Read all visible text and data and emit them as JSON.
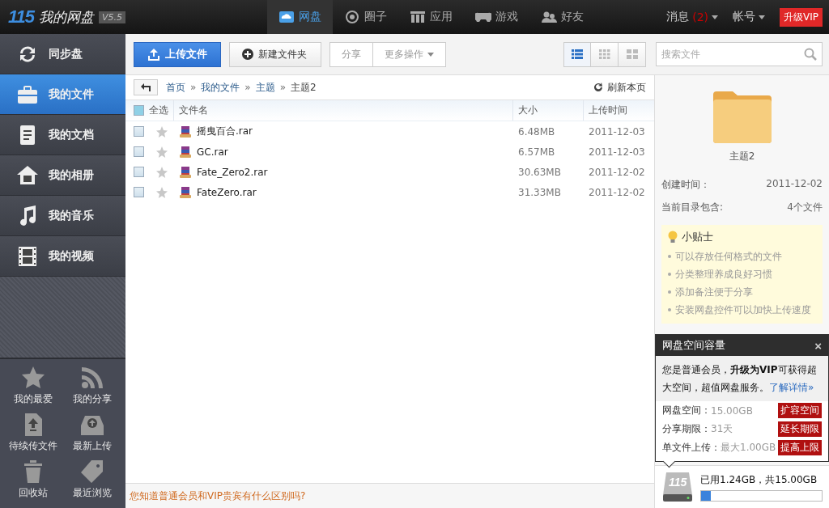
{
  "app": {
    "logo": "115",
    "title": "我的网盘",
    "version": "V5.5"
  },
  "nav_tabs": [
    {
      "label": "网盘",
      "selected": true
    },
    {
      "label": "圈子",
      "selected": false
    },
    {
      "label": "应用",
      "selected": false
    },
    {
      "label": "游戏",
      "selected": false
    },
    {
      "label": "好友",
      "selected": false
    }
  ],
  "header_right": {
    "messages": "消息",
    "message_count": "(2)",
    "account": "帐号",
    "upgrade": "升级VIP"
  },
  "sidebar": {
    "items": [
      {
        "label": "同步盘",
        "selected": false
      },
      {
        "label": "我的文件",
        "selected": true
      },
      {
        "label": "我的文档",
        "selected": false
      },
      {
        "label": "我的相册",
        "selected": false
      },
      {
        "label": "我的音乐",
        "selected": false
      },
      {
        "label": "我的视频",
        "selected": false
      }
    ],
    "shortcuts": [
      "我的最爱",
      "我的分享",
      "待续传文件",
      "最新上传",
      "回收站",
      "最近浏览"
    ]
  },
  "toolbar": {
    "upload": "上传文件",
    "new_folder": "新建文件夹",
    "share": "分享",
    "more": "更多操作",
    "views": [
      {
        "selected": true
      },
      {
        "selected": false
      },
      {
        "selected": false
      }
    ]
  },
  "search": {
    "placeholder": "搜索文件"
  },
  "breadcrumb": [
    {
      "label": "首页"
    },
    {
      "separator": "»",
      "label": "我的文件"
    },
    {
      "separator": "»",
      "label": "主题"
    },
    {
      "separator": "»",
      "label": "主题2"
    }
  ],
  "refresh": "刷新本页",
  "table": {
    "select_all": "全选",
    "select_all_checked": false,
    "columns": [
      "文件名",
      "大小",
      "上传时间"
    ],
    "rows": [
      {
        "name": "摇曳百合.rar",
        "size": "6.48MB",
        "date": "2011-12-03",
        "checked": false,
        "starred": false
      },
      {
        "name": "GC.rar",
        "size": "6.57MB",
        "date": "2011-12-03",
        "checked": false,
        "starred": false
      },
      {
        "name": "Fate_Zero2.rar",
        "size": "30.63MB",
        "date": "2011-12-02",
        "checked": false,
        "starred": false
      },
      {
        "name": "FateZero.rar",
        "size": "31.33MB",
        "date": "2011-12-02",
        "checked": false,
        "starred": false
      }
    ]
  },
  "footer_link": "您知道普通会员和VIP贵宾有什么区别吗?",
  "details": {
    "folder_name": "主题2",
    "fields": [
      {
        "label": "创建时间：",
        "value": "2011-12-02"
      },
      {
        "label": "当前目录包含:",
        "value": "4个文件"
      }
    ]
  },
  "tips": {
    "title": "小贴士",
    "items": [
      "可以存放任何格式的文件",
      "分类整理养成良好习惯",
      "添加备注便于分享",
      "安装网盘控件可以加快上传速度"
    ]
  },
  "storage_popup": {
    "title": "网盘空间容量",
    "close": "×",
    "message": "您是普通会员，**升级为VIP**可获得超大空间，超值网盘服务。",
    "link": "了解详情»",
    "rows": [
      {
        "label": "网盘空间：",
        "value": "15.00GB",
        "action": "扩容空间"
      },
      {
        "label": "分享期限：",
        "value": "31天",
        "action": "延长期限"
      },
      {
        "label": "单文件上传：",
        "value": "最大1.00GB",
        "action": "提高上限"
      }
    ]
  },
  "storage": {
    "logo": "115",
    "usage": "已用1.24GB，共15.00GB",
    "level": 0.08
  }
}
